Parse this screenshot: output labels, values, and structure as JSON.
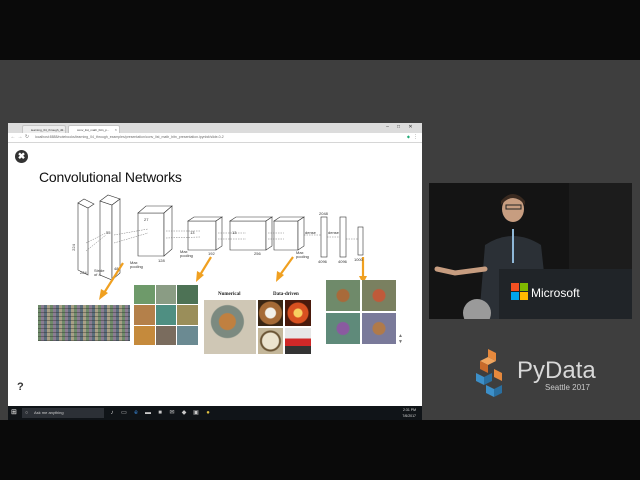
{
  "browser": {
    "tabs": [
      {
        "label": "learning_04_through_sc..."
      },
      {
        "label": "conv_list_math_bitn_p..."
      }
    ],
    "url": "localhost:8888/notebooks/learning_04_through_examples/presentation/conv_list_math_bitn_presentation.ipynb#/slide-0-2"
  },
  "slide": {
    "title": "Convolutional Networks",
    "help_symbol": "?",
    "close_symbol": "✖",
    "captions": {
      "stride": "Stride of 4",
      "max_pooling_1": "Max pooling",
      "max_pooling_2": "Max pooling",
      "max_pooling_3": "Max pooling",
      "dense_1": "dense",
      "dense_2": "dense",
      "size_224a": "224",
      "size_224b": "224",
      "n_4096a": "4096",
      "n_4096b": "4096",
      "n_1000": "1000",
      "n_2048": "2048",
      "n_128": "128",
      "n_192": "192",
      "n_256": "256",
      "n_48": "48",
      "n_13a": "13",
      "n_13b": "13",
      "n_27": "27",
      "n_55": "55",
      "numerical": "Numerical",
      "data_driven": "Data-driven"
    }
  },
  "taskbar": {
    "search_placeholder": "Ask me anything",
    "time": "2:31 PM",
    "date": "7/6/2017"
  },
  "venue": {
    "sponsor": "Microsoft",
    "conference_name": "PyData",
    "conference_sub": "Seattle 2017"
  },
  "colors": {
    "arrow": "#f0a020",
    "pydata_orange": "#e6893d",
    "pydata_blue": "#3c8fc8"
  }
}
